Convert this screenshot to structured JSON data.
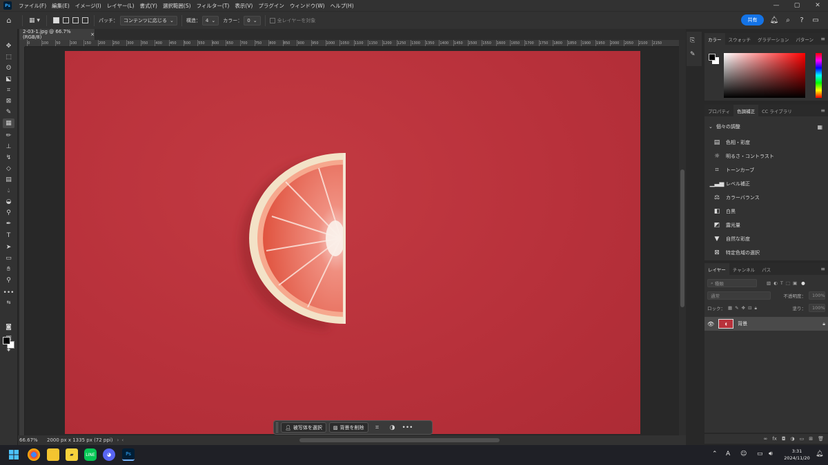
{
  "menubar": {
    "logo": "Ps",
    "items": [
      "ファイル(F)",
      "編集(E)",
      "イメージ(I)",
      "レイヤー(L)",
      "書式(Y)",
      "選択範囲(S)",
      "フィルター(T)",
      "表示(V)",
      "プラグイン",
      "ウィンドウ(W)",
      "ヘルプ(H)"
    ],
    "window_controls": {
      "minimize": "—",
      "maximize": "▢",
      "close": "✕"
    }
  },
  "options": {
    "patch_label": "パッチ：",
    "patch_value": "コンテンツに応じる",
    "structure_label": "構造：",
    "structure_value": "4",
    "color_label": "カラー：",
    "color_value": "0",
    "sample_all_label": "全レイヤーを対象",
    "share_label": "共有"
  },
  "document": {
    "tab_title": "2-03-1.jpg @ 66.7% (RGB/8)",
    "tab_close": "×",
    "zoom": "66.67%",
    "info": "2000 px x 1335 px (72 ppi)",
    "ruler_ticks": [
      "0",
      "100",
      "50",
      "100",
      "150",
      "200",
      "250",
      "300",
      "350",
      "400",
      "450",
      "500",
      "550",
      "600",
      "650",
      "700",
      "750",
      "800",
      "850",
      "900",
      "950",
      "1000",
      "1050",
      "1100",
      "1150",
      "1200",
      "1250",
      "1300",
      "1350",
      "1400",
      "1450",
      "1500",
      "1550",
      "1600",
      "1650",
      "1700",
      "1750",
      "1800",
      "1850",
      "1900",
      "1950",
      "2000",
      "2050",
      "2100",
      "2150"
    ]
  },
  "context_bar": {
    "select_subject": "被写体を選択",
    "remove_background": "背景を削除",
    "more": "•••"
  },
  "panels": {
    "color_tabs": [
      "カラー",
      "スウォッチ",
      "グラデーション",
      "パターン"
    ],
    "adjust_tabs": [
      "プロパティ",
      "色調補正",
      "CC ライブラリ"
    ],
    "adjust_heading": "個々の調整",
    "adjustments": [
      "色相・彩度",
      "明るさ・コントラスト",
      "トーンカーブ",
      "レベル補正",
      "カラーバランス",
      "白黒",
      "露光量",
      "自然な彩度",
      "特定色域の選択"
    ],
    "layer_tabs": [
      "レイヤー",
      "チャンネル",
      "パス"
    ],
    "layer_search_placeholder": "種類",
    "blend_mode": "通常",
    "opacity_label": "不透明度：",
    "opacity_value": "100%",
    "lock_label": "ロック：",
    "fill_label": "塗り：",
    "fill_value": "100%",
    "layer_name": "背景",
    "footer_icons": [
      "∞",
      "fx",
      "◘",
      "◑",
      "▭",
      "⊞",
      "🗑"
    ]
  },
  "taskbar": {
    "ps_label": "Ps",
    "time": "3:31",
    "date": "2024/11/20",
    "ime": "A"
  },
  "colors": {
    "canvas_red": "#b8323b",
    "accent_blue": "#1473e6",
    "panel_bg": "#323232"
  }
}
